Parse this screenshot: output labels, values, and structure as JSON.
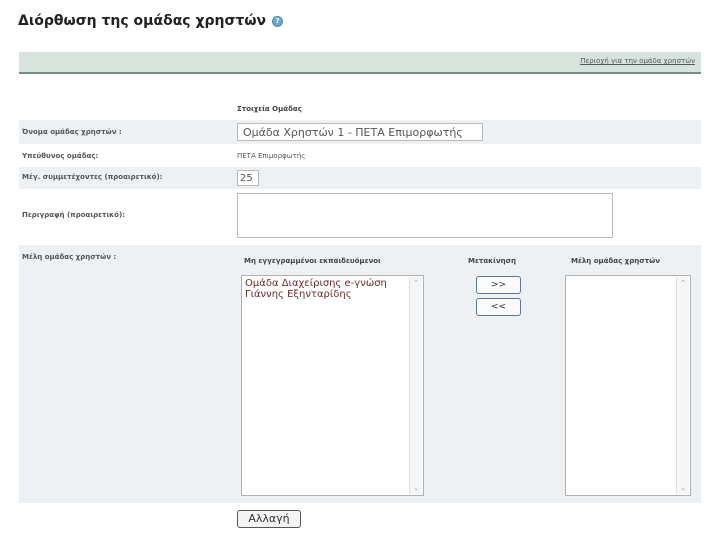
{
  "page": {
    "title": "Διόρθωση της ομάδας χρηστών",
    "help_icon": "help-icon",
    "help_glyph": "?"
  },
  "toolbar": {
    "link": "Περιοχή για την ομάδα χρηστών"
  },
  "form": {
    "section_heading": "Στοιχεία Ομάδας",
    "name_label": "Όνομα ομάδας χρηστών :",
    "name_value": "Ομάδα Χρηστών 1 - ΠΕΤΑ Επιμορφωτής",
    "owner_label": "Υπεύθυνος ομάδας:",
    "owner_value": "ΠΕΤΑ Επιμορφωτής",
    "max_label": "Μέγ. συμμετέχοντες (προαιρετικό):",
    "max_value": "25",
    "desc_label": "Περιγραφή (προαιρετικό):",
    "members_label": "Μέλη ομάδας χρηστών :"
  },
  "members": {
    "unregistered_header": "Μη εγγεγραμμένοι εκπαιδευόμενοι",
    "move_header": "Μετακίνηση",
    "group_header": "Μέλη ομάδας χρηστών",
    "unregistered_items": [
      "Ομάδα Διαχείρισης e-γνώση",
      "Γιάννης Εξηνταρίδης"
    ],
    "group_items": [],
    "move_right_label": ">>",
    "move_left_label": "<<",
    "scroll_up_glyph": "⌃",
    "scroll_down_glyph": "⌄"
  },
  "actions": {
    "save_label": "Αλλαγή"
  }
}
